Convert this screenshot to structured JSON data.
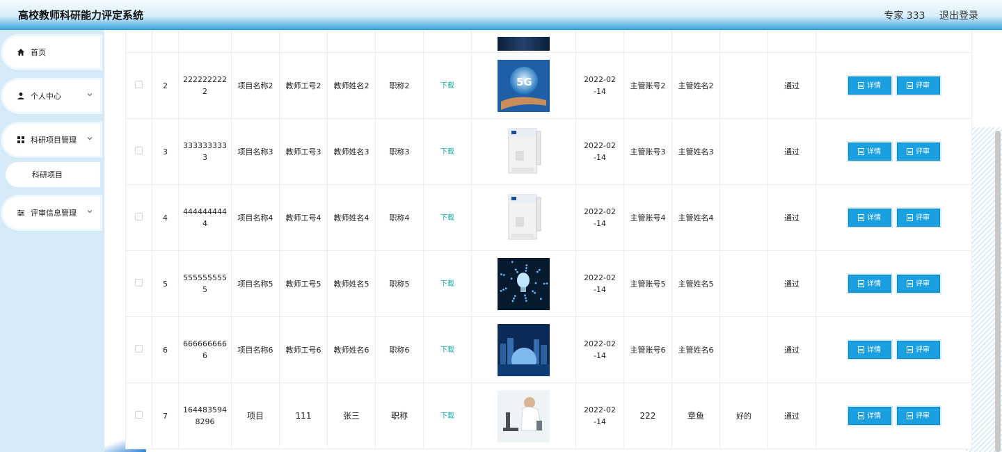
{
  "header": {
    "title": "高校教师科研能力评定系统",
    "user": "专家 333",
    "logout": "退出登录"
  },
  "sidebar": {
    "home": "首页",
    "personal": "个人中心",
    "project_mgmt": "科研项目管理",
    "project_item": "科研项目",
    "review_mgmt": "评审信息管理"
  },
  "table": {
    "download_label": "下载",
    "detail_label": "详情",
    "review_label": "评审",
    "rows": [
      {
        "index": "2",
        "number": "2222222222",
        "project": "项目名称2",
        "teacher_no": "教师工号2",
        "teacher_name": "教师姓名2",
        "title": "职称2",
        "image": "5g-hand-image",
        "date": "2022-02-14",
        "mgr_account": "主管账号2",
        "mgr_name": "主管姓名2",
        "opinion": "",
        "status": "通过"
      },
      {
        "index": "3",
        "number": "3333333333",
        "project": "项目名称3",
        "teacher_no": "教师工号3",
        "teacher_name": "教师姓名3",
        "title": "职称3",
        "image": "water-machine-image",
        "date": "2022-02-14",
        "mgr_account": "主管账号3",
        "mgr_name": "主管姓名3",
        "opinion": "",
        "status": "通过"
      },
      {
        "index": "4",
        "number": "4444444444",
        "project": "项目名称4",
        "teacher_no": "教师工号4",
        "teacher_name": "教师姓名4",
        "title": "职称4",
        "image": "water-machine-image",
        "date": "2022-02-14",
        "mgr_account": "主管账号4",
        "mgr_name": "主管姓名4",
        "opinion": "",
        "status": "通过"
      },
      {
        "index": "5",
        "number": "5555555555",
        "project": "项目名称5",
        "teacher_no": "教师工号5",
        "teacher_name": "教师姓名5",
        "title": "职称5",
        "image": "lightbulb-image",
        "date": "2022-02-14",
        "mgr_account": "主管账号5",
        "mgr_name": "主管姓名5",
        "opinion": "",
        "status": "通过"
      },
      {
        "index": "6",
        "number": "6666666666",
        "project": "项目名称6",
        "teacher_no": "教师工号6",
        "teacher_name": "教师姓名6",
        "title": "职称6",
        "image": "city-globe-image",
        "date": "2022-02-14",
        "mgr_account": "主管账号6",
        "mgr_name": "主管姓名6",
        "opinion": "",
        "status": "通过"
      },
      {
        "index": "7",
        "number": "1644835948296",
        "project": "项目",
        "teacher_no": "111",
        "teacher_name": "张三",
        "title": "职称",
        "image": "lab-microscope-image",
        "date": "2022-02-14",
        "mgr_account": "222",
        "mgr_name": "章鱼",
        "opinion": "好的",
        "status": "通过"
      }
    ]
  },
  "colors": {
    "accent": "#1a9fe0",
    "download": "#13a89e",
    "header_edge": "#3fa6de"
  }
}
